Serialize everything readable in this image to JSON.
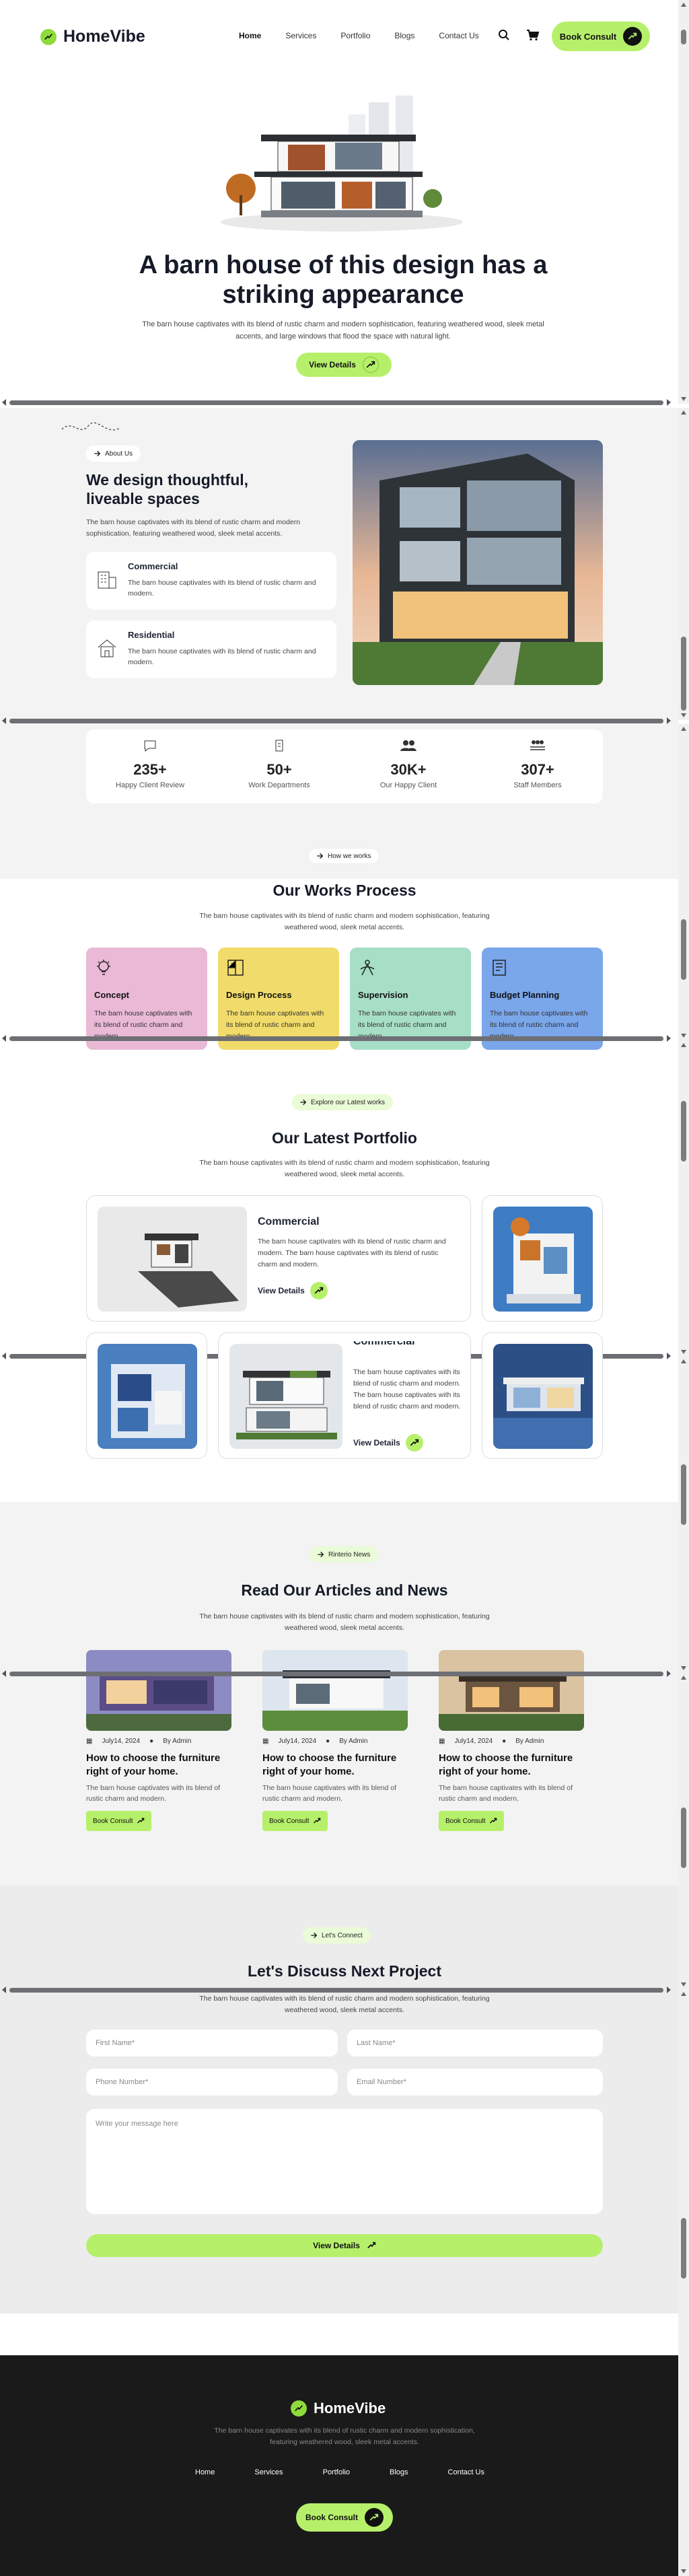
{
  "brand": {
    "name": "HomeVibe"
  },
  "nav": {
    "items": [
      "Home",
      "Services",
      "Portfolio",
      "Blogs",
      "Contact Us"
    ],
    "cta": "Book Consult"
  },
  "hero": {
    "title": "A barn house of this design has a striking appearance",
    "desc": "The barn house captivates with its blend of rustic charm and modern sophistication, featuring weathered wood, sleek metal accents, and large windows that flood the space with natural light.",
    "cta": "View Details"
  },
  "about": {
    "tag": "About Us",
    "title": "We design thoughtful, liveable spaces",
    "desc": "The barn house captivates with its blend of rustic charm and modern sophistication, featuring weathered wood, sleek metal accents.",
    "features": [
      {
        "title": "Commercial",
        "desc": "The barn house captivates with its blend of rustic charm and modern."
      },
      {
        "title": "Residential",
        "desc": "The barn house captivates with its blend of rustic charm and modern."
      }
    ]
  },
  "stats": [
    {
      "value": "235+",
      "label": "Happy Client Review"
    },
    {
      "value": "50+",
      "label": "Work Departments"
    },
    {
      "value": "30K+",
      "label": "Our Happy Client"
    },
    {
      "value": "307+",
      "label": "Staff Members"
    }
  ],
  "process": {
    "tag": "How we works",
    "title": "Our Works Process",
    "desc": "The barn house captivates with its blend of rustic charm and modern sophistication, featuring weathered wood, sleek metal accents.",
    "steps": [
      {
        "title": "Concept",
        "desc": "The barn house captivates with its blend of rustic charm and modern.",
        "color": "#e9b9d6"
      },
      {
        "title": "Design Process",
        "desc": "The barn house captivates with its blend of rustic charm and modern.",
        "color": "#f1dc6b"
      },
      {
        "title": "Supervision",
        "desc": "The barn house captivates with its blend of rustic charm and modern.",
        "color": "#a7dec6"
      },
      {
        "title": "Budget Planning",
        "desc": "The barn house captivates with its blend of rustic charm and modern.",
        "color": "#7aa6ea"
      }
    ]
  },
  "portfolio": {
    "tag": "Explore our Latest works",
    "title": "Our Latest Portfolio",
    "desc": "The barn house captivates with its blend of rustic charm and modern sophistication, featuring weathered wood, sleek metal accents.",
    "featured": {
      "title": "Commercial",
      "desc": "The barn house captivates with its blend of rustic charm and modern. The barn house captivates with its blend of rustic charm and modern.",
      "cta": "View Details"
    },
    "second": {
      "title": "Commercial",
      "desc": "The barn house captivates with its blend of rustic charm and modern. The barn house captivates with its blend of rustic charm and modern.",
      "cta": "View Details"
    }
  },
  "news": {
    "tag": "Rinterio News",
    "title": "Read Our Articles and News",
    "desc": "The barn house captivates with its blend of rustic charm and modern sophistication, featuring weathered wood, sleek metal accents.",
    "items": [
      {
        "date": "July14, 2024",
        "author": "By Admin",
        "title": "How to choose the furniture right of your home.",
        "desc": "The barn house captivates with its blend of rustic charm and modern.",
        "cta": "Book Consult"
      },
      {
        "date": "July14, 2024",
        "author": "By Admin",
        "title": "How to choose the furniture right of your home.",
        "desc": "The barn house captivates with its blend of rustic charm and modern.",
        "cta": "Book Consult"
      },
      {
        "date": "July14, 2024",
        "author": "By Admin",
        "title": "How to choose the furniture right of your home.",
        "desc": "The barn house captivates with its blend of rustic charm and modern.",
        "cta": "Book Consult"
      }
    ]
  },
  "contact": {
    "tag": "Let's Connect",
    "title": "Let's Discuss Next Project",
    "desc": "The barn house captivates with its blend of rustic charm and modern sophistication, featuring weathered wood, sleek metal accents.",
    "first_name": "First Name*",
    "last_name": "Last Name*",
    "phone": "Phone Number*",
    "email": "Email Number*",
    "message": "Write your message here",
    "submit": "View Details"
  },
  "footer": {
    "desc": "The barn house captivates with its blend of rustic charm and modern sophistication, featuring weathered wood, sleek metal accents.",
    "cta": "Book Consult"
  },
  "colors": {
    "accent": "#b6f06a",
    "dark": "#1a1a1a",
    "text": "#151b28"
  }
}
